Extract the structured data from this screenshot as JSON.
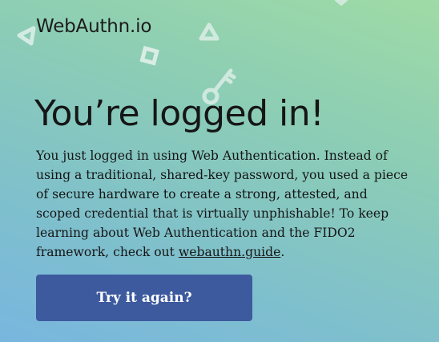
{
  "header": {
    "logo_text": "WebAuthn.io"
  },
  "main": {
    "heading": "You’re logged in!",
    "paragraph_before_link": "You just logged in using Web Authentication. Instead of using a traditional, shared-key password, you used a piece of secure hardware to create a strong, attested, and scoped credential that is virtually unphishable! To keep learning about Web Authentication and the FIDO2 framework, check out ",
    "guide_link_text": "webauthn.guide",
    "paragraph_after_link": ".",
    "retry_button_label": "Try it again?"
  },
  "decorations": {
    "icons": [
      "triangle-icon",
      "square-icon",
      "triangle-icon",
      "key-icon",
      "triangle-icon"
    ],
    "color": "#e8f3f0"
  },
  "theme": {
    "button_color": "#3d5a9e",
    "gradient_colors": [
      "#9fdba5",
      "#79b6df"
    ]
  }
}
